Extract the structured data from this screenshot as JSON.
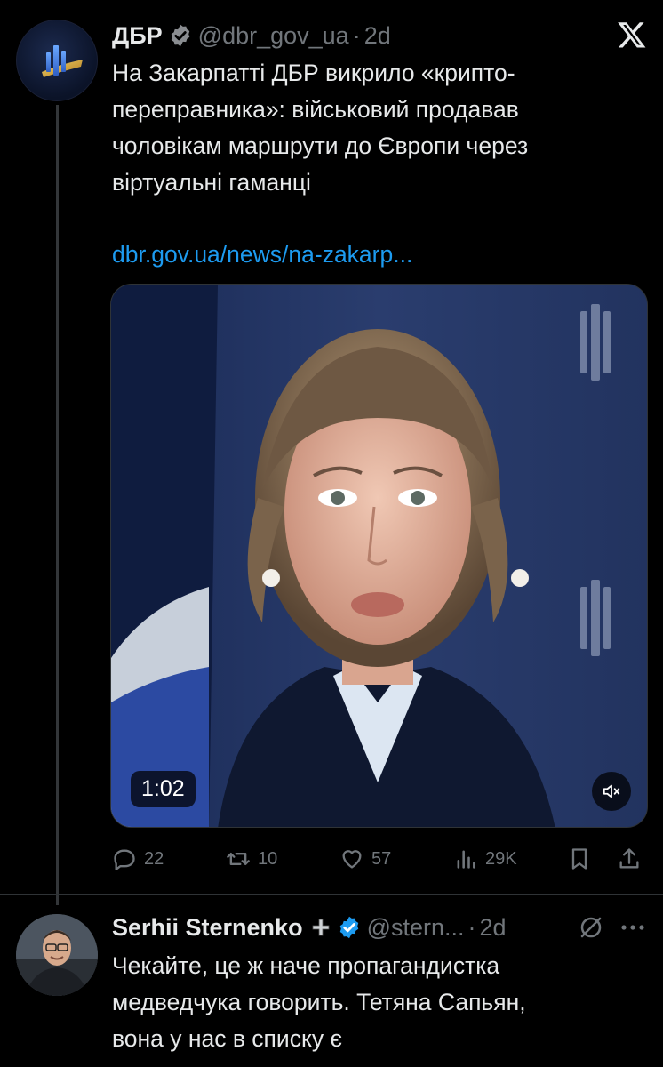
{
  "tweet": {
    "author_name": "ДБР",
    "handle": "@dbr_gov_ua",
    "separator": "·",
    "time": "2d",
    "text": "На Закарпатті ДБР викрило «крипто-\nпереправника»: військовий продавав\nчоловікам маршрути до Європи через\nвіртуальні гаманці",
    "link": "dbr.gov.ua/news/na-zakarp...",
    "video": {
      "duration": "1:02"
    },
    "actions": {
      "replies": "22",
      "reposts": "10",
      "likes": "57",
      "views": "29K"
    }
  },
  "reply": {
    "author_name": "Serhii Sternenko",
    "handle": "@stern...",
    "separator": "·",
    "time": "2d",
    "text": "Чекайте, це ж наче пропагандистка\nмедведчука говорить. Тетяна Сапьян,\nвона у нас в списку є"
  },
  "colors": {
    "background": "#000000",
    "text": "#e7e9ea",
    "muted": "#71767b",
    "link": "#1d9bf0",
    "verified_gold": "#e2b719",
    "verified_blue": "#1d9bf0"
  },
  "icons": [
    "x-logo-icon",
    "verified-badge-icon",
    "reply-icon",
    "repost-icon",
    "like-icon",
    "views-icon",
    "bookmark-icon",
    "share-icon",
    "mute-icon",
    "grok-icon",
    "more-icon",
    "cross-icon"
  ]
}
